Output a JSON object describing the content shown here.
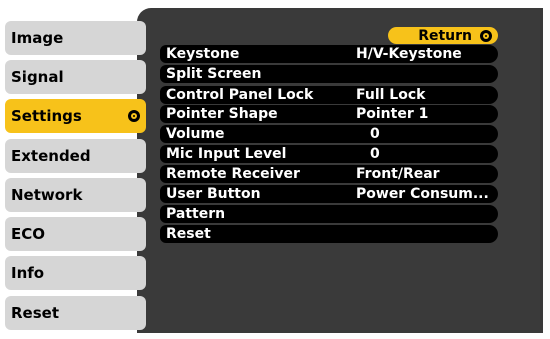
{
  "tabs": [
    {
      "label": "Image",
      "active": false
    },
    {
      "label": "Signal",
      "active": false
    },
    {
      "label": "Settings",
      "active": true
    },
    {
      "label": "Extended",
      "active": false
    },
    {
      "label": "Network",
      "active": false
    },
    {
      "label": "ECO",
      "active": false
    },
    {
      "label": "Info",
      "active": false
    },
    {
      "label": "Reset",
      "active": false
    }
  ],
  "return_label": "Return",
  "settings_items": [
    {
      "label": "Keystone",
      "value": "H/V-Keystone"
    },
    {
      "label": "Split Screen",
      "value": ""
    },
    {
      "label": "Control Panel Lock",
      "value": "Full Lock"
    },
    {
      "label": "Pointer Shape",
      "value": "Pointer 1"
    },
    {
      "label": "Volume",
      "value": "0"
    },
    {
      "label": "Mic Input Level",
      "value": "0"
    },
    {
      "label": "Remote Receiver",
      "value": "Front/Rear"
    },
    {
      "label": "User Button",
      "value": "Power Consum..."
    },
    {
      "label": "Pattern",
      "value": ""
    },
    {
      "label": "Reset",
      "value": ""
    }
  ],
  "colors": {
    "accent": "#f7c21a",
    "tab_bg": "#d6d6d6",
    "panel_bg": "#3a3a3a",
    "row_bg": "#000000"
  },
  "icons": {
    "enter": "enter-icon"
  }
}
